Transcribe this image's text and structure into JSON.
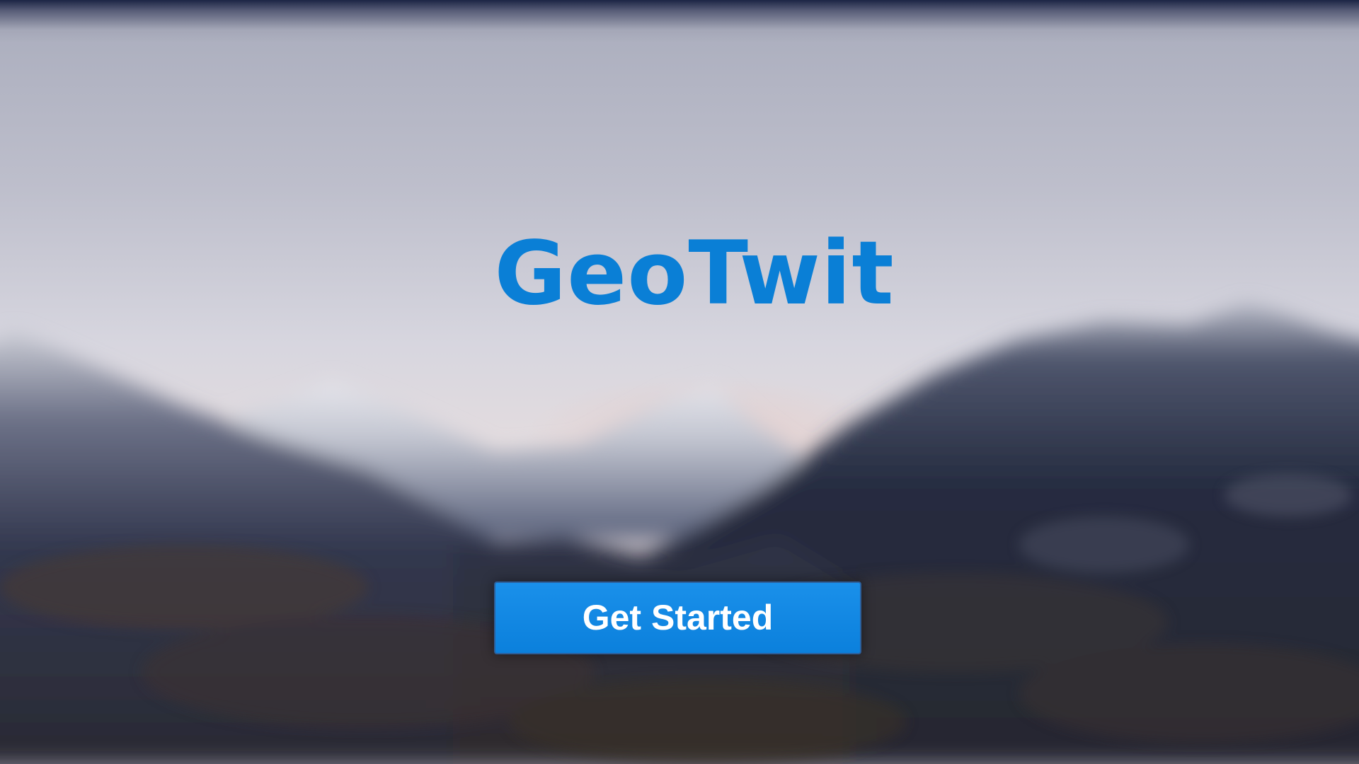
{
  "app": {
    "title": "GeoTwit"
  },
  "hero": {
    "cta_label": "Get Started"
  },
  "colors": {
    "accent": "#0a7fd6",
    "button": "#0b80dc",
    "button_text": "#ffffff"
  },
  "background": {
    "image": "blurred-mountain-landscape"
  }
}
